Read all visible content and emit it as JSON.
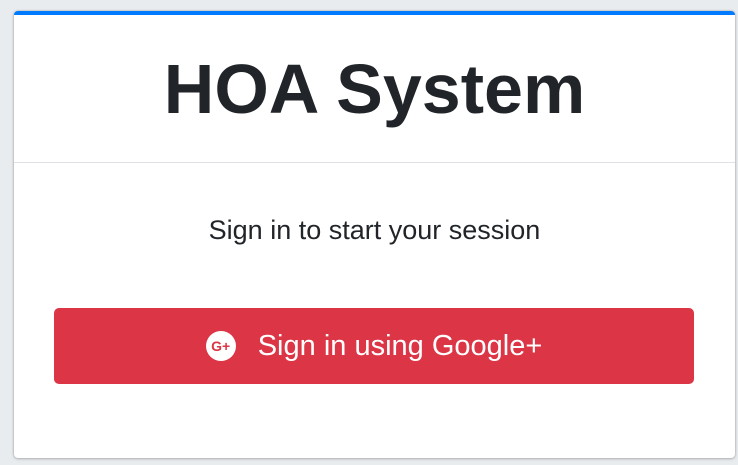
{
  "header": {
    "title": "HOA System"
  },
  "body": {
    "login_message": "Sign in to start your session",
    "google_button": {
      "label": "Sign in using Google+",
      "icon": "google-plus-icon",
      "icon_glyph": "G+"
    }
  },
  "colors": {
    "accent": "#007bff",
    "danger": "#dc3545"
  }
}
